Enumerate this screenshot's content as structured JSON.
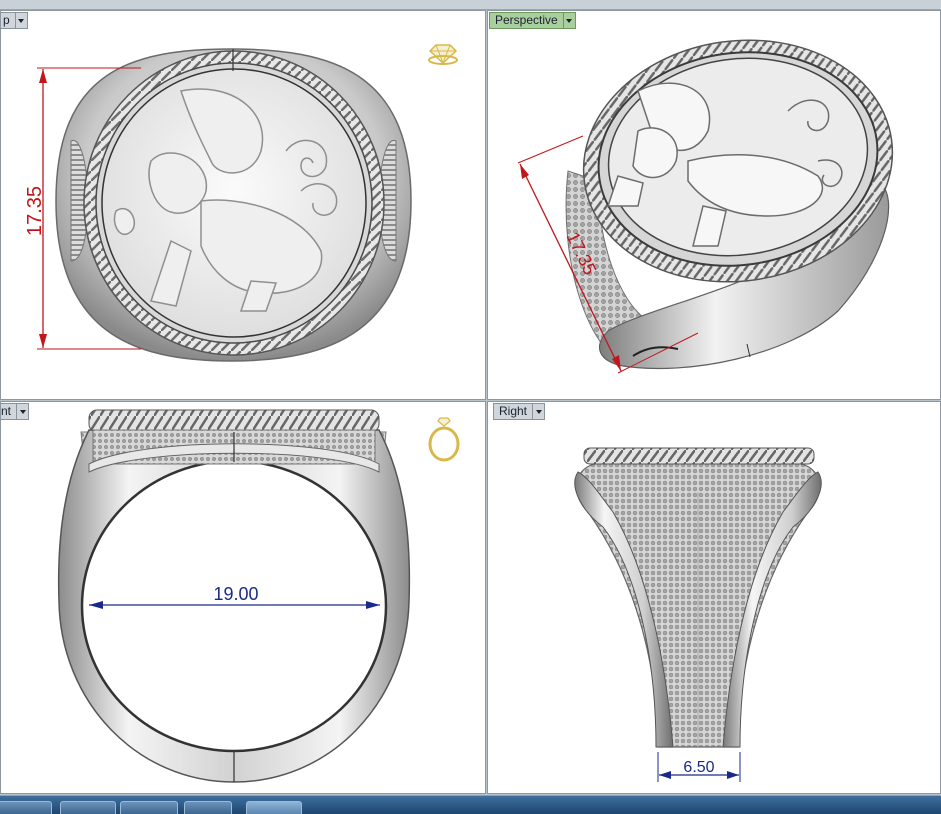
{
  "viewports": {
    "top": {
      "label": "p"
    },
    "perspective": {
      "label": "Perspective"
    },
    "front": {
      "label": "nt"
    },
    "right": {
      "label": "Right"
    }
  },
  "dimensions": {
    "top_height": "17.35",
    "perspective_height": "17.35",
    "inner_diameter": "19.00",
    "shank_width": "6.50"
  },
  "icons": {
    "top_gizmo": "diamond-ring-icon",
    "front_gizmo": "ring-icon"
  },
  "colors": {
    "active_label": "#a9cf9e",
    "dimension_red": "#c0161c",
    "dimension_blue": "#1a2a8a",
    "gizmo_gold": "#d9b84a"
  }
}
